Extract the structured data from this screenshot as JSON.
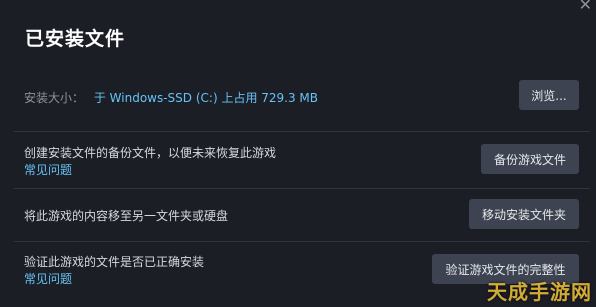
{
  "dialog": {
    "title": "已安装文件"
  },
  "install_size": {
    "label": "安装大小：",
    "value": "于 Windows-SSD (C:) 上占用 729.3 MB",
    "button": "浏览..."
  },
  "backup": {
    "description": "创建安装文件的备份文件，以便未来恢复此游戏",
    "help_link": "常见问题",
    "button": "备份游戏文件"
  },
  "move": {
    "description": "将此游戏的内容移至另一文件夹或硬盘",
    "button": "移动安装文件夹"
  },
  "verify": {
    "description": "验证此游戏的文件是否已正确安装",
    "help_link": "常见问题",
    "button": "验证游戏文件的完整性"
  },
  "watermark": "天成手游网"
}
